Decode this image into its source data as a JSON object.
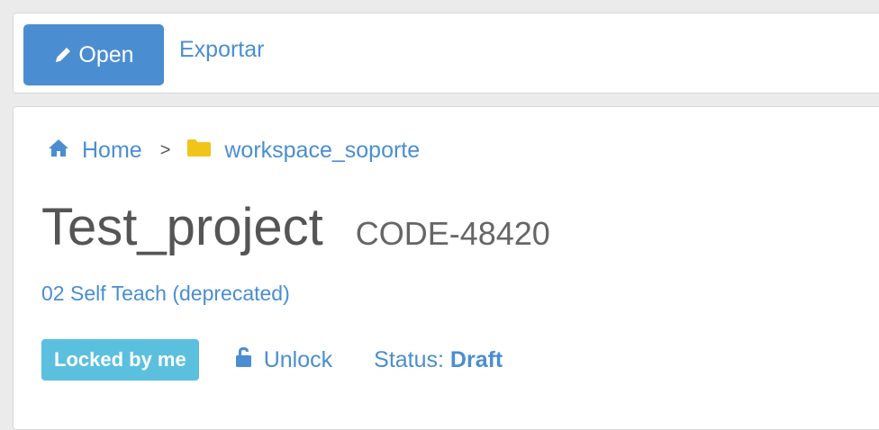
{
  "toolbar": {
    "open_label": "Open",
    "export_label": "Exportar"
  },
  "breadcrumb": {
    "home_label": "Home",
    "separator": ">",
    "folder_label": "workspace_soporte"
  },
  "project": {
    "title": "Test_project",
    "code": "CODE-48420",
    "subtitle": "02 Self Teach (deprecated)"
  },
  "status_bar": {
    "locked_badge": "Locked by me",
    "unlock_label": "Unlock",
    "status_label": "Status:",
    "status_value": "Draft"
  },
  "colors": {
    "accent": "#4a8ed1",
    "badge": "#5bc0de",
    "folder": "#f0c419",
    "title_text": "#555555"
  },
  "icons": {
    "open_button": "pencil-icon",
    "home": "home-icon",
    "folder": "folder-icon",
    "unlock": "unlock-icon"
  }
}
